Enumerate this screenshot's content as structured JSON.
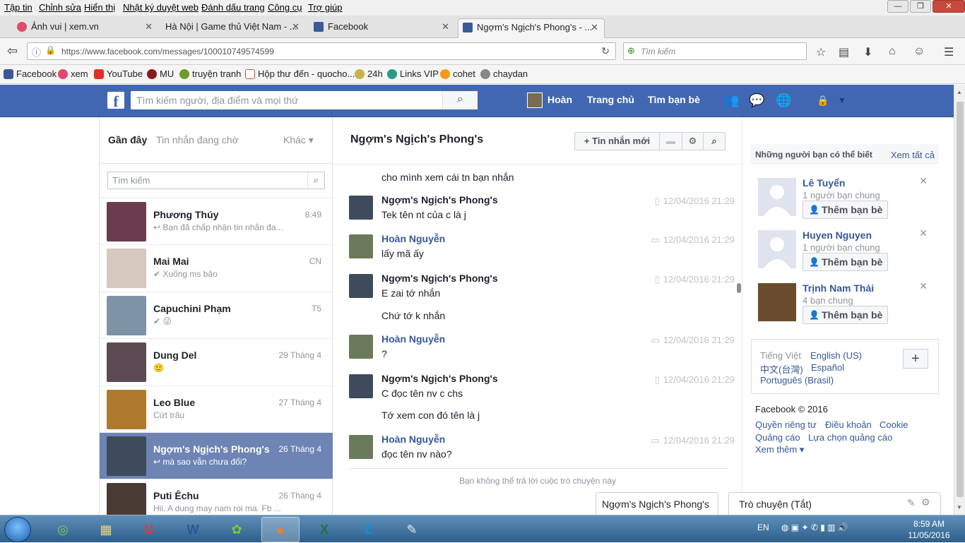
{
  "menubar": {
    "items": [
      "Tập tin",
      "Chỉnh sửa",
      "Hiển thị",
      "Nhật ký duyệt web",
      "Đánh dấu trang",
      "Công cụ",
      "Trợ giúp"
    ]
  },
  "tabs": [
    {
      "label": "Ảnh vui | xem.vn",
      "active": false
    },
    {
      "label": "Hà Nội | Game thủ Việt Nam - ...",
      "active": false
    },
    {
      "label": "Facebook",
      "active": false
    },
    {
      "label": "Ngợm's Ngịch's Phong's - ...",
      "active": true
    }
  ],
  "navbar": {
    "url": "https://www.facebook.com/messages/100010749574599",
    "search_placeholder": "Tìm kiếm"
  },
  "bookmarks": [
    "Facebook",
    "xem",
    "YouTube",
    "MU",
    "truyện tranh",
    "Hộp thư đến - quocho...",
    "24h",
    "Links VIP",
    "cohet",
    "chaydan"
  ],
  "fb_header": {
    "search_placeholder": "Tìm kiếm người, địa điểm và mọi thứ",
    "user": "Hoàn",
    "home": "Trang chủ",
    "find_friends": "Tìm bạn bè"
  },
  "left": {
    "tab_recent": "Gần đây",
    "tab_pending": "Tin nhắn đang chờ",
    "tab_other": "Khác",
    "search_placeholder": "Tìm kiếm",
    "conversations": [
      {
        "name": "Phương Thúy",
        "time": "8:49",
        "snippet": "↩ Bạn đã chấp nhận tin nhắn đa...",
        "color": "#6b3b4e",
        "selected": false
      },
      {
        "name": "Mai Mai",
        "time": "CN",
        "snippet": "✔ Xuống ms bảo",
        "color": "#d7c9bf",
        "selected": false
      },
      {
        "name": "Capuchini Phạm",
        "time": "T5",
        "snippet": "✔ 😜",
        "color": "#7f93a6",
        "selected": false
      },
      {
        "name": "Dung Del",
        "time": "29 Tháng 4",
        "snippet": "🙂",
        "color": "#5e4a52",
        "selected": false
      },
      {
        "name": "Leo Blue",
        "time": "27 Tháng 4",
        "snippet": "Cứt trâu",
        "color": "#b07a2e",
        "selected": false
      },
      {
        "name": "Ngợm's Ngịch's Phong's",
        "time": "26 Tháng 4",
        "snippet": "↩ mà sao vẫn chưa đổi?",
        "color": "#3d4b5c",
        "selected": true
      },
      {
        "name": "Puti Êchu",
        "time": "26 Tháng 4",
        "snippet": "Hii. A dung may nam roi ma. Fb ...",
        "color": "#4a3b35",
        "selected": false
      }
    ]
  },
  "middle": {
    "title": "Ngợm's Ngịch's Phong's",
    "new_message": "+ Tin nhắn mới",
    "messages": [
      {
        "sender": "",
        "text": "cho mình xem cái tn bạn nhắn",
        "time": "",
        "me": false
      },
      {
        "sender": "Ngợm's Ngịch's Phong's",
        "text": "Tek tên nt của c là j",
        "time": "12/04/2016 21:29",
        "me": false
      },
      {
        "sender": "Hoàn Nguyễn",
        "text": "lấy mã ấy",
        "time": "12/04/2016 21:29",
        "me": true
      },
      {
        "sender": "Ngợm's Ngịch's Phong's",
        "text": "E zai tớ nhắn",
        "time": "12/04/2016 21:29",
        "me": false
      },
      {
        "sender": "",
        "text": "Chứ tớ k nhắn",
        "time": "",
        "me": false
      },
      {
        "sender": "Hoàn Nguyễn",
        "text": "?",
        "time": "12/04/2016 21:29",
        "me": true
      },
      {
        "sender": "Ngợm's Ngịch's Phong's",
        "text": "C đọc tên nv c chs",
        "time": "12/04/2016 21:29",
        "me": false
      },
      {
        "sender": "",
        "text": "Tớ xem con đó tên là j",
        "time": "",
        "me": false
      },
      {
        "sender": "Hoàn Nguyễn",
        "text": "đọc tên nv nào?",
        "time": "12/04/2016 21:29",
        "me": true
      }
    ],
    "cant_reply": "Bạn không thể trả lời cuộc trò chuyện này"
  },
  "right": {
    "pymk_title": "Những người bạn có thể biết",
    "see_all": "Xem tất cả",
    "people": [
      {
        "name": "Lê Tuyển",
        "mutual": "1 người bạn chung",
        "add": "Thêm bạn bè"
      },
      {
        "name": "Huyen Nguyen",
        "mutual": "1 người bạn chung",
        "add": "Thêm bạn bè"
      },
      {
        "name": "Trịnh Nam Thái",
        "mutual": "4 bạn chung",
        "add": "Thêm bạn bè"
      }
    ],
    "languages": {
      "current": "Tiếng Việt",
      "l1": "English (US)",
      "l2": "中文(台灣)",
      "l3": "Español",
      "l4": "Português (Brasil)"
    },
    "copyright": "Facebook © 2016",
    "footer": {
      "privacy": "Quyền riêng tư",
      "terms": "Điều khoản",
      "cookie": "Cookie",
      "ads": "Quảng cáo",
      "adchoices": "Lựa chọn quảng cáo",
      "more": "Xem thêm ▾"
    }
  },
  "chat": {
    "tab": "Ngợm's Ngịch's Phong's",
    "status": "Trò chuyện (Tắt)"
  },
  "taskbar": {
    "lang": "EN",
    "time": "8:59 AM",
    "date": "11/05/2016"
  }
}
